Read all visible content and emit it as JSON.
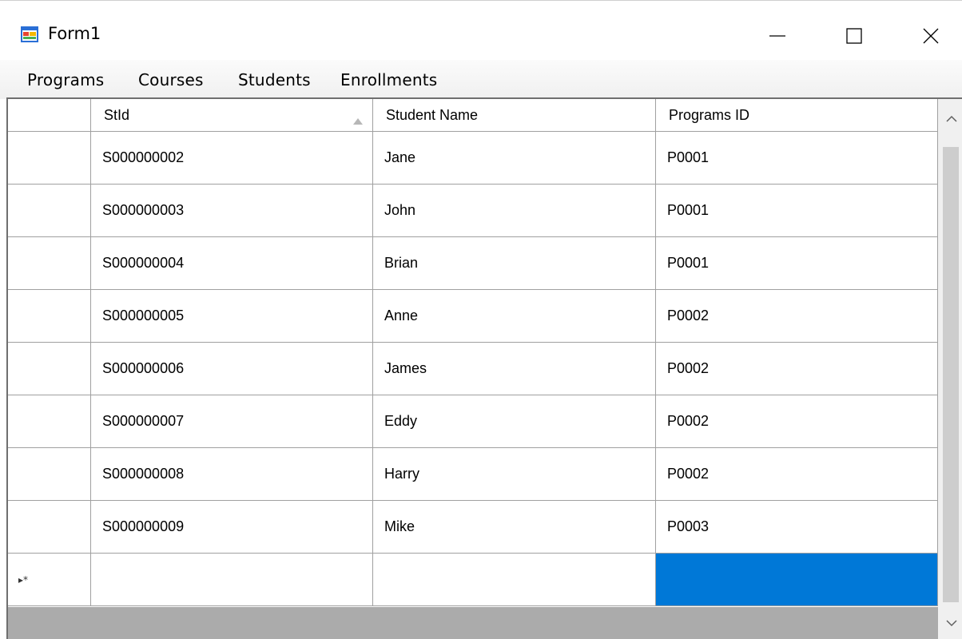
{
  "window": {
    "title": "Form1",
    "app_icon": "winforms-form-icon",
    "caption_buttons": [
      "minimize-icon",
      "maximize-icon",
      "close-icon"
    ]
  },
  "menu": {
    "items": [
      {
        "label": "Programs"
      },
      {
        "label": "Courses"
      },
      {
        "label": "Students"
      },
      {
        "label": "Enrollments"
      }
    ]
  },
  "grid": {
    "columns": [
      {
        "label": "StId",
        "sorted": "ascending"
      },
      {
        "label": "Student Name"
      },
      {
        "label": "Programs ID"
      }
    ],
    "rows": [
      {
        "stid": "S000000002",
        "name": "Jane",
        "program": "P0001"
      },
      {
        "stid": "S000000003",
        "name": "John",
        "program": "P0001"
      },
      {
        "stid": "S000000004",
        "name": "Brian",
        "program": "P0001"
      },
      {
        "stid": "S000000005",
        "name": "Anne",
        "program": "P0002"
      },
      {
        "stid": "S000000006",
        "name": "James",
        "program": "P0002"
      },
      {
        "stid": "S000000007",
        "name": "Eddy",
        "program": "P0002"
      },
      {
        "stid": "S000000008",
        "name": "Harry",
        "program": "P0002"
      },
      {
        "stid": "S000000009",
        "name": "Mike",
        "program": "P0003"
      }
    ],
    "new_row_marker": "▸*",
    "selection_color": "#0078d7"
  }
}
